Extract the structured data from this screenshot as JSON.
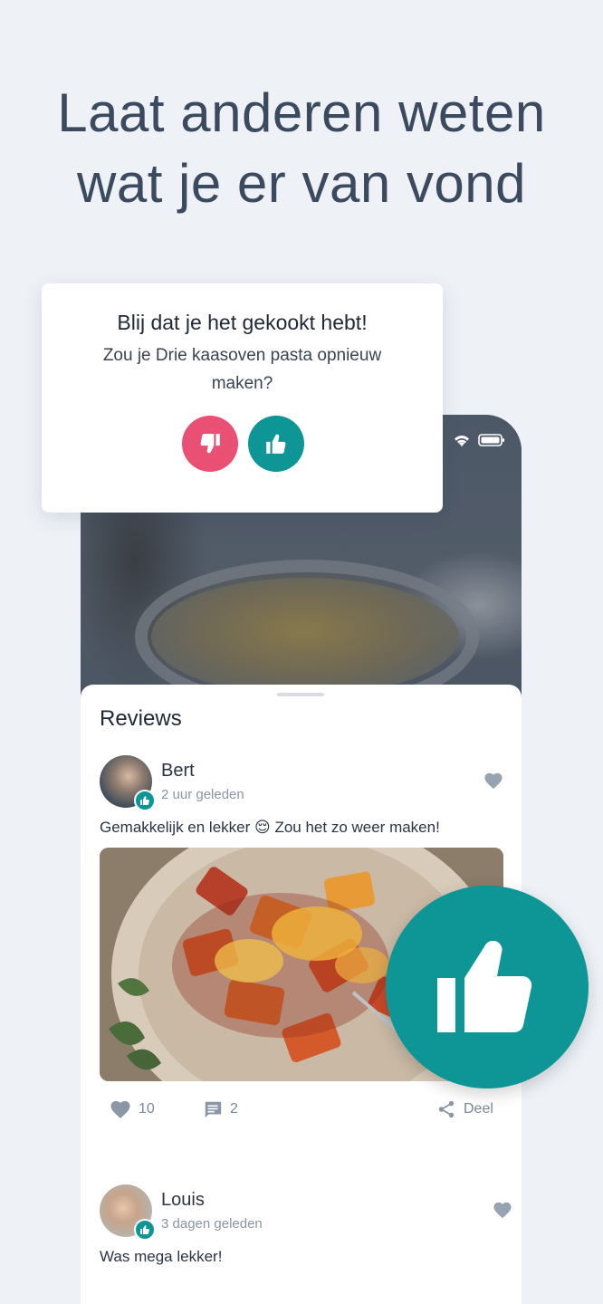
{
  "headline": {
    "line1": "Laat anderen weten",
    "line2": "wat je er van vond"
  },
  "dialog": {
    "title": "Blij dat je het gekookt hebt!",
    "question": "Zou je Drie kaasoven pasta opnieuw maken?",
    "dislike_icon": "thumbs-down-icon",
    "like_icon": "thumbs-up-icon"
  },
  "phone": {
    "status_icons": [
      "wifi-icon",
      "battery-icon"
    ]
  },
  "reviews": {
    "title": "Reviews",
    "items": [
      {
        "name": "Bert",
        "time": "2 uur geleden",
        "text": "Gemakkelijk en lekker 😌 Zou het zo weer maken!",
        "likes": "10",
        "comments": "2",
        "share": "Deel"
      },
      {
        "name": "Louis",
        "time": "3 dagen geleden",
        "text": "Was mega lekker!"
      }
    ]
  },
  "colors": {
    "teal": "#0e9596",
    "pink": "#ea4f74",
    "headline": "#3b4a5e",
    "background": "#eef2f7"
  }
}
